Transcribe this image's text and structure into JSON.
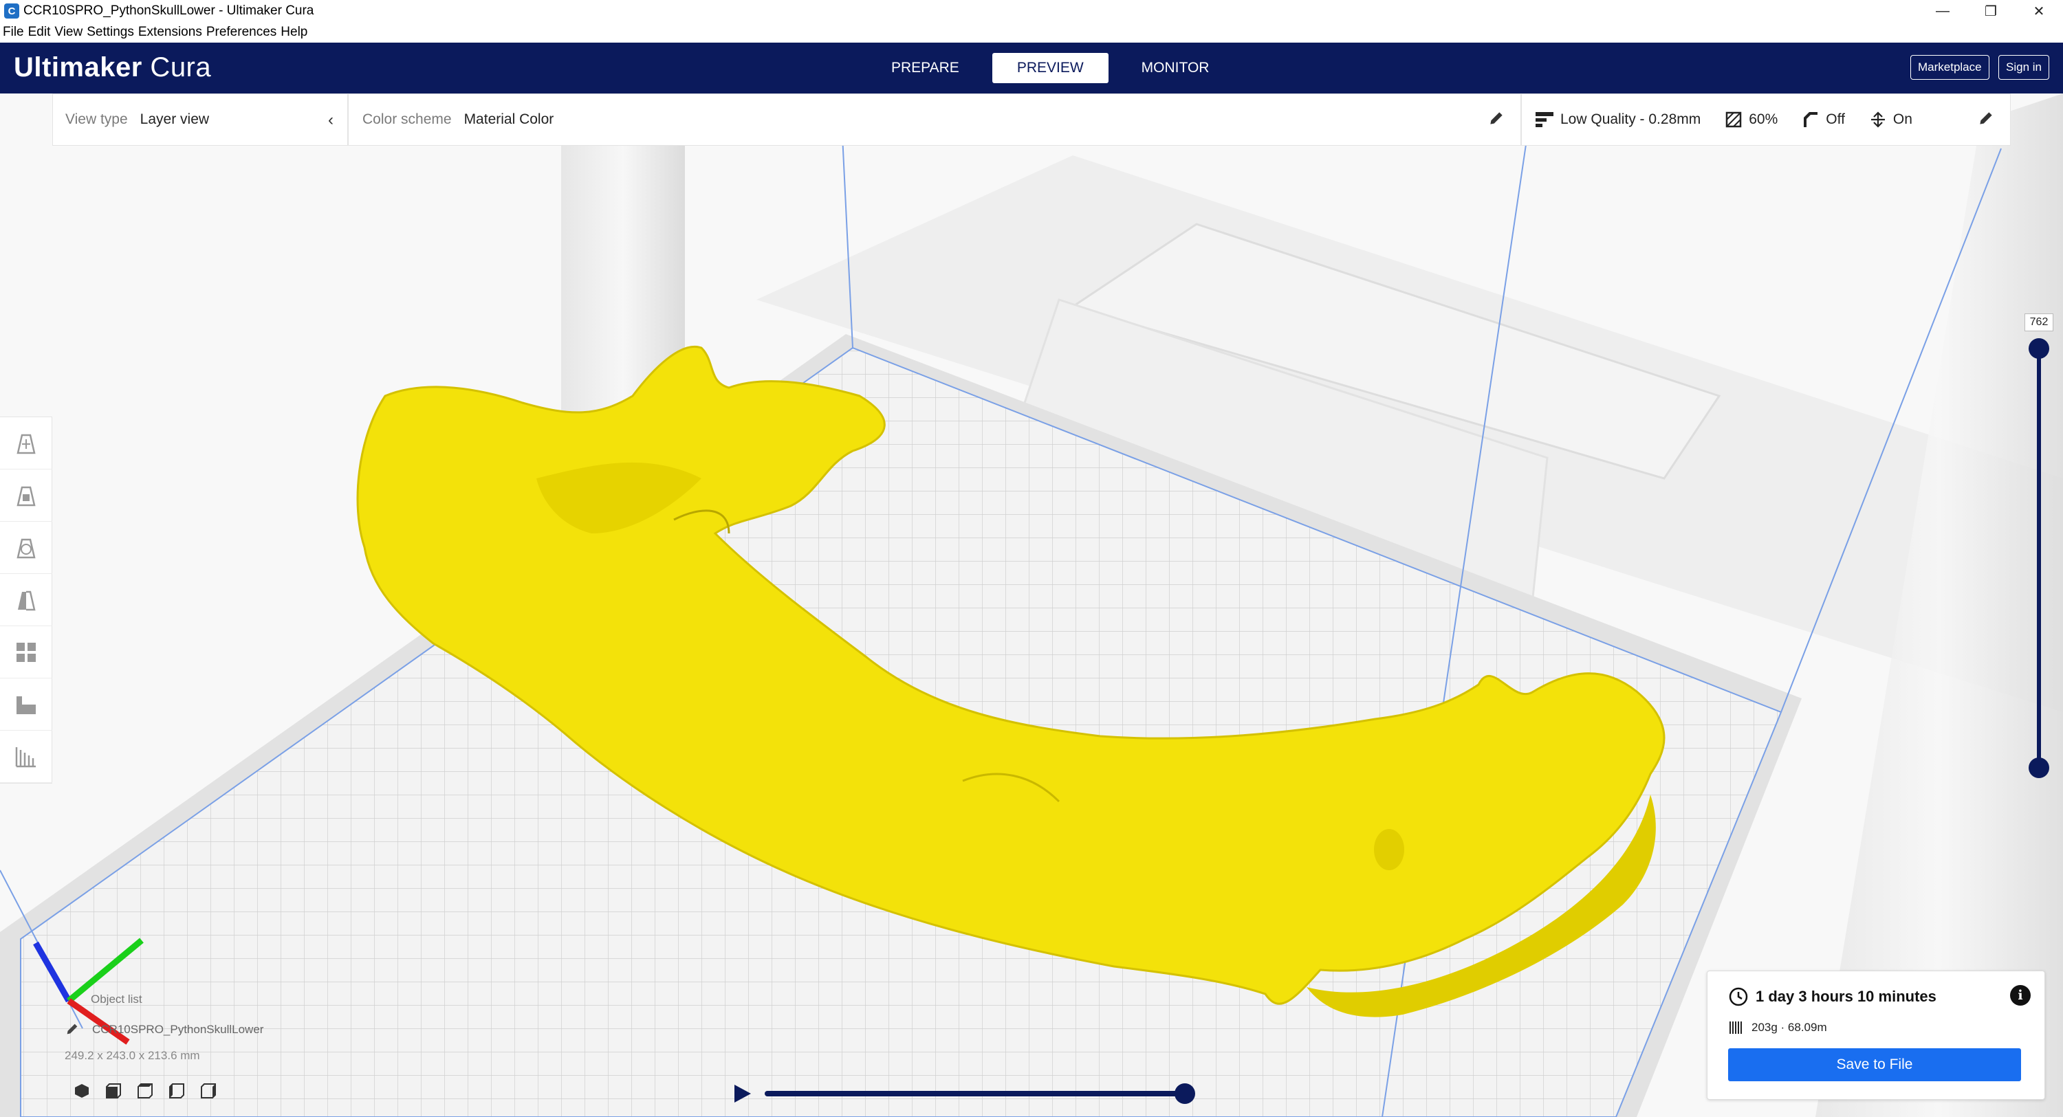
{
  "window": {
    "title": "CCR10SPRO_PythonSkullLower - Ultimaker Cura",
    "app_icon": "C",
    "controls": [
      "minimize-icon",
      "restore-icon",
      "close-icon"
    ]
  },
  "menu": [
    "File",
    "Edit",
    "View",
    "Settings",
    "Extensions",
    "Preferences",
    "Help"
  ],
  "header": {
    "logo_bold": "Ultimaker",
    "logo_light": " Cura",
    "stages": [
      {
        "label": "PREPARE",
        "active": false
      },
      {
        "label": "PREVIEW",
        "active": true
      },
      {
        "label": "MONITOR",
        "active": false
      }
    ],
    "marketplace": "Marketplace",
    "signin": "Sign in"
  },
  "view_panel": {
    "label": "View type",
    "value": "Layer view"
  },
  "color_panel": {
    "label": "Color scheme",
    "value": "Material Color"
  },
  "print_settings": {
    "profile": "Low Quality - 0.28mm",
    "infill": "60%",
    "support": "Off",
    "adhesion": "On"
  },
  "layer_slider": {
    "current_layer": "762"
  },
  "object_list": {
    "label": "Object list",
    "name": "CCR10SPRO_PythonSkullLower",
    "dimensions": "249.2 x 243.0 x 213.6 mm"
  },
  "print_info": {
    "time": "1 day 3 hours 10 minutes",
    "material": "203g · 68.09m",
    "save_label": "Save to File"
  },
  "colors": {
    "header_bg": "#0b1a5c",
    "accent": "#196ef0",
    "model": "#f3e20a",
    "build_plate": "#f2f2f2"
  }
}
